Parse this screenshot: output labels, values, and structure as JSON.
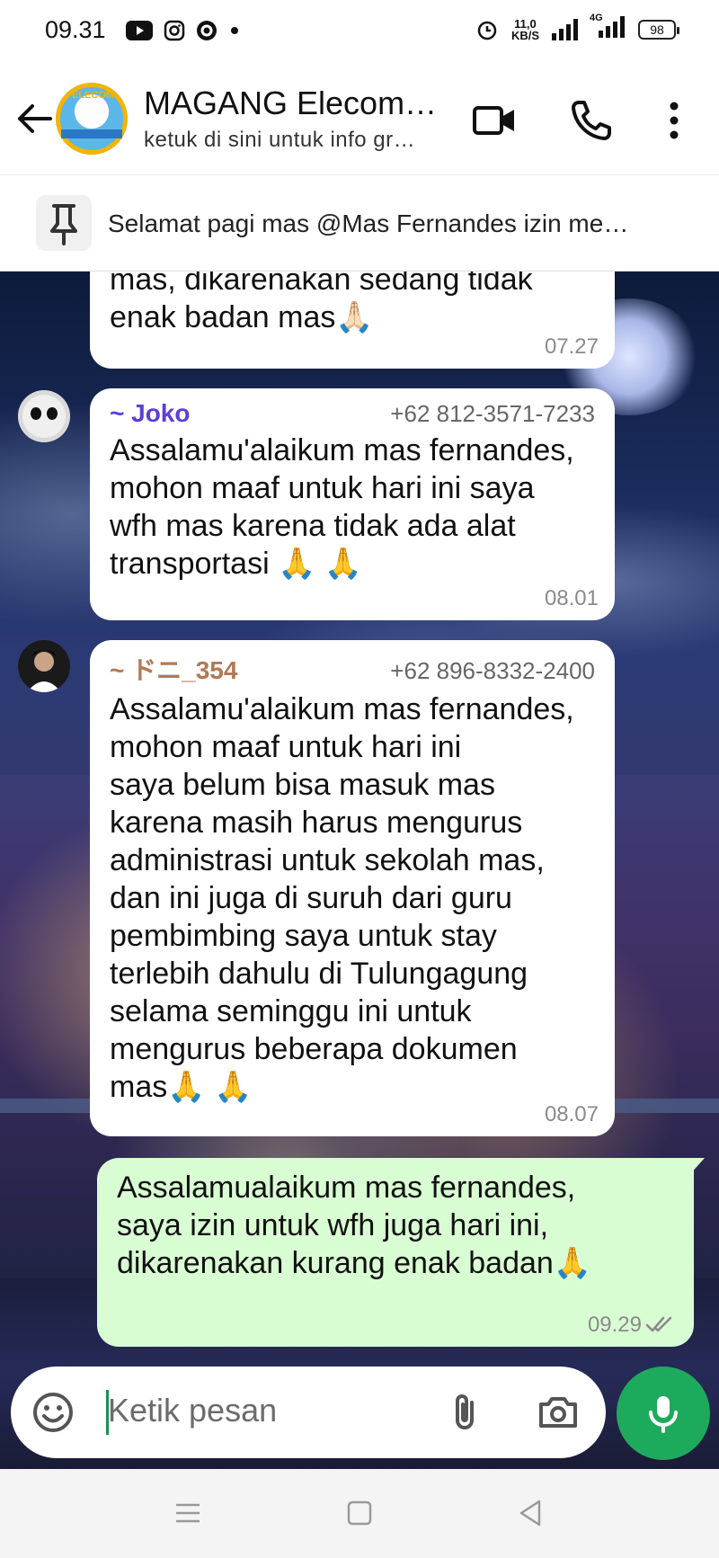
{
  "status_bar": {
    "time": "09.31",
    "net_speed_value": "11,0",
    "net_speed_unit": "KB/S",
    "network": "4G",
    "battery": "98",
    "icons": [
      "youtube-icon",
      "instagram-icon",
      "notification-app-icon",
      "dot-icon",
      "alarm-icon",
      "signal-icon",
      "signal-4g-icon",
      "battery-icon"
    ]
  },
  "header": {
    "title": "MAGANG Elecom…",
    "subtitle": "ketuk di sini untuk info gr…"
  },
  "pinned": {
    "text": "Selamat pagi mas @Mas Fernandes izin me…"
  },
  "messages": [
    {
      "direction": "in",
      "continued": true,
      "text": "mas, dikarenakan sedang tidak\nenak badan mas🙏🏻",
      "time": "07.27"
    },
    {
      "direction": "in",
      "sender": "~ Joko",
      "phone": "+62 812-3571-7233",
      "sender_color": "#5b3fd6",
      "text": "Assalamu'alaikum mas fernandes,\nmohon maaf untuk hari ini saya\nwfh mas karena tidak ada alat\ntransportasi 🙏 🙏",
      "time": "08.01"
    },
    {
      "direction": "in",
      "sender": "~ ドニ_354",
      "phone": "+62 896-8332-2400",
      "sender_color": "#b07a55",
      "text": "Assalamu'alaikum mas fernandes,\nmohon maaf untuk hari ini\nsaya belum bisa masuk mas\nkarena masih harus mengurus\nadministrasi untuk sekolah mas,\ndan ini juga di suruh dari guru\npembimbing saya untuk stay\nterlebih dahulu di Tulungagung\nselama seminggu ini untuk\nmengurus beberapa dokumen\nmas🙏 🙏",
      "time": "08.07"
    },
    {
      "direction": "out",
      "text": "Assalamualaikum mas fernandes,\nsaya izin untuk wfh juga hari ini,\ndikarenakan kurang enak badan🙏",
      "time": "09.29",
      "status": "read"
    }
  ],
  "composer": {
    "placeholder": "Ketik pesan"
  }
}
